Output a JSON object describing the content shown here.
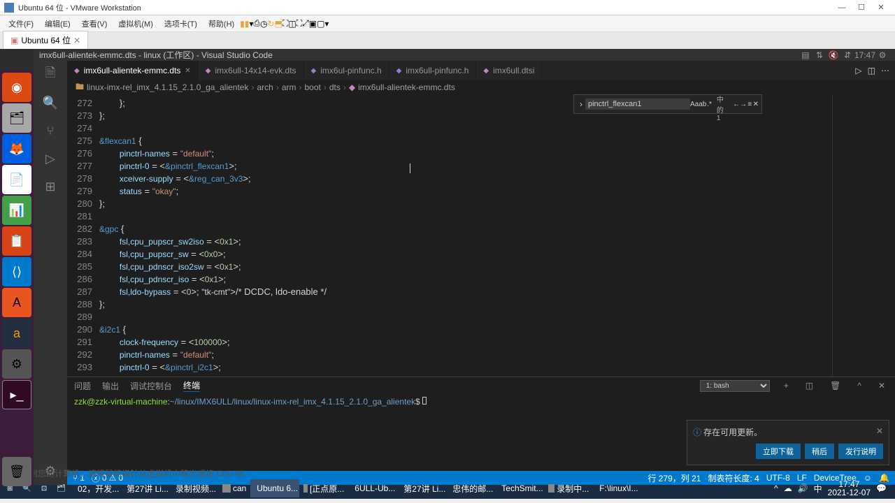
{
  "vmware": {
    "title": "Ubuntu 64 位 - VMware Workstation",
    "menu": [
      "文件(F)",
      "编辑(E)",
      "查看(V)",
      "虚拟机(M)",
      "选项卡(T)",
      "帮助(H)"
    ],
    "tab": "Ubuntu 64 位"
  },
  "vscode": {
    "title": "imx6ull-alientek-emmc.dts - linux (工作区) - Visual Studio Code",
    "clock": "17:47",
    "tabs": [
      {
        "label": "imx6ull-alientek-emmc.dts",
        "active": true,
        "dirty": false
      },
      {
        "label": "imx6ull-14x14-evk.dts",
        "active": false
      },
      {
        "label": "imx6ul-pinfunc.h",
        "active": false
      },
      {
        "label": "imx6ull-pinfunc.h",
        "active": false
      },
      {
        "label": "imx6ull.dtsi",
        "active": false
      }
    ],
    "breadcrumb": [
      "linux-imx-rel_imx_4.1.15_2.1.0_ga_alientek",
      "arch",
      "arm",
      "boot",
      "dts",
      "imx6ull-alientek-emmc.dts"
    ],
    "find": {
      "value": "pinctrl_flexcan1",
      "result": "2 中的 1"
    },
    "code_lines": [
      {
        "n": 272,
        "t": "        };"
      },
      {
        "n": 273,
        "t": "};"
      },
      {
        "n": 274,
        "t": ""
      },
      {
        "n": 275,
        "t": "&flexcan1 {"
      },
      {
        "n": 276,
        "t": "        pinctrl-names = \"default\";"
      },
      {
        "n": 277,
        "t": "        pinctrl-0 = <&pinctrl_flexcan1>;"
      },
      {
        "n": 278,
        "t": "        xceiver-supply = <&reg_can_3v3>;"
      },
      {
        "n": 279,
        "t": "        status = \"okay\";"
      },
      {
        "n": 280,
        "t": "};"
      },
      {
        "n": 281,
        "t": ""
      },
      {
        "n": 282,
        "t": "&gpc {"
      },
      {
        "n": 283,
        "t": "        fsl,cpu_pupscr_sw2iso = <0x1>;"
      },
      {
        "n": 284,
        "t": "        fsl,cpu_pupscr_sw = <0x0>;"
      },
      {
        "n": 285,
        "t": "        fsl,cpu_pdnscr_iso2sw = <0x1>;"
      },
      {
        "n": 286,
        "t": "        fsl,cpu_pdnscr_iso = <0x1>;"
      },
      {
        "n": 287,
        "t": "        fsl,ldo-bypass = <0>; /* DCDC, ldo-enable */"
      },
      {
        "n": 288,
        "t": "};"
      },
      {
        "n": 289,
        "t": ""
      },
      {
        "n": 290,
        "t": "&i2c1 {"
      },
      {
        "n": 291,
        "t": "        clock-frequency = <100000>;"
      },
      {
        "n": 292,
        "t": "        pinctrl-names = \"default\";"
      },
      {
        "n": 293,
        "t": "        pinctrl-0 = <&pinctrl_i2c1>;"
      }
    ],
    "panel_tabs": [
      "问题",
      "输出",
      "调试控制台",
      "终端"
    ],
    "panel_active": 3,
    "terminal_dropdown": "1: bash",
    "terminal_prompt_user": "zzk@zzk-virtual-machine",
    "terminal_prompt_path": "~/linux/IMX6ULL/linux/linux-imx-rel_imx_4.1.15_2.1.0_ga_alientek",
    "terminal_prompt_suffix": "$ ",
    "notification": {
      "msg": "存在可用更新。",
      "btns": [
        "立即下载",
        "稍后",
        "发行说明"
      ]
    },
    "status": {
      "errors": "0",
      "warnings": "0",
      "line_col": "行 279，列 21",
      "tab": "制表符长度: 4",
      "enc": "UTF-8",
      "eol": "LF",
      "lang": "DeviceTree"
    }
  },
  "host_status": "要返回到您的计算机，请将鼠标指针从虚拟机中移出或按 Ctrl+Alt.",
  "taskbar": {
    "items": [
      "02，开发...",
      "第27讲 Li...",
      "录制视频...",
      "can",
      "Ubuntu 6...",
      "[正点原...",
      "6ULL-Ub...",
      "第27讲 Li...",
      "忠伟的邮...",
      "TechSmit...",
      "录制中...",
      "F:\\linux\\I..."
    ],
    "tray_time": "17:47",
    "tray_date": "2021-12-07"
  }
}
